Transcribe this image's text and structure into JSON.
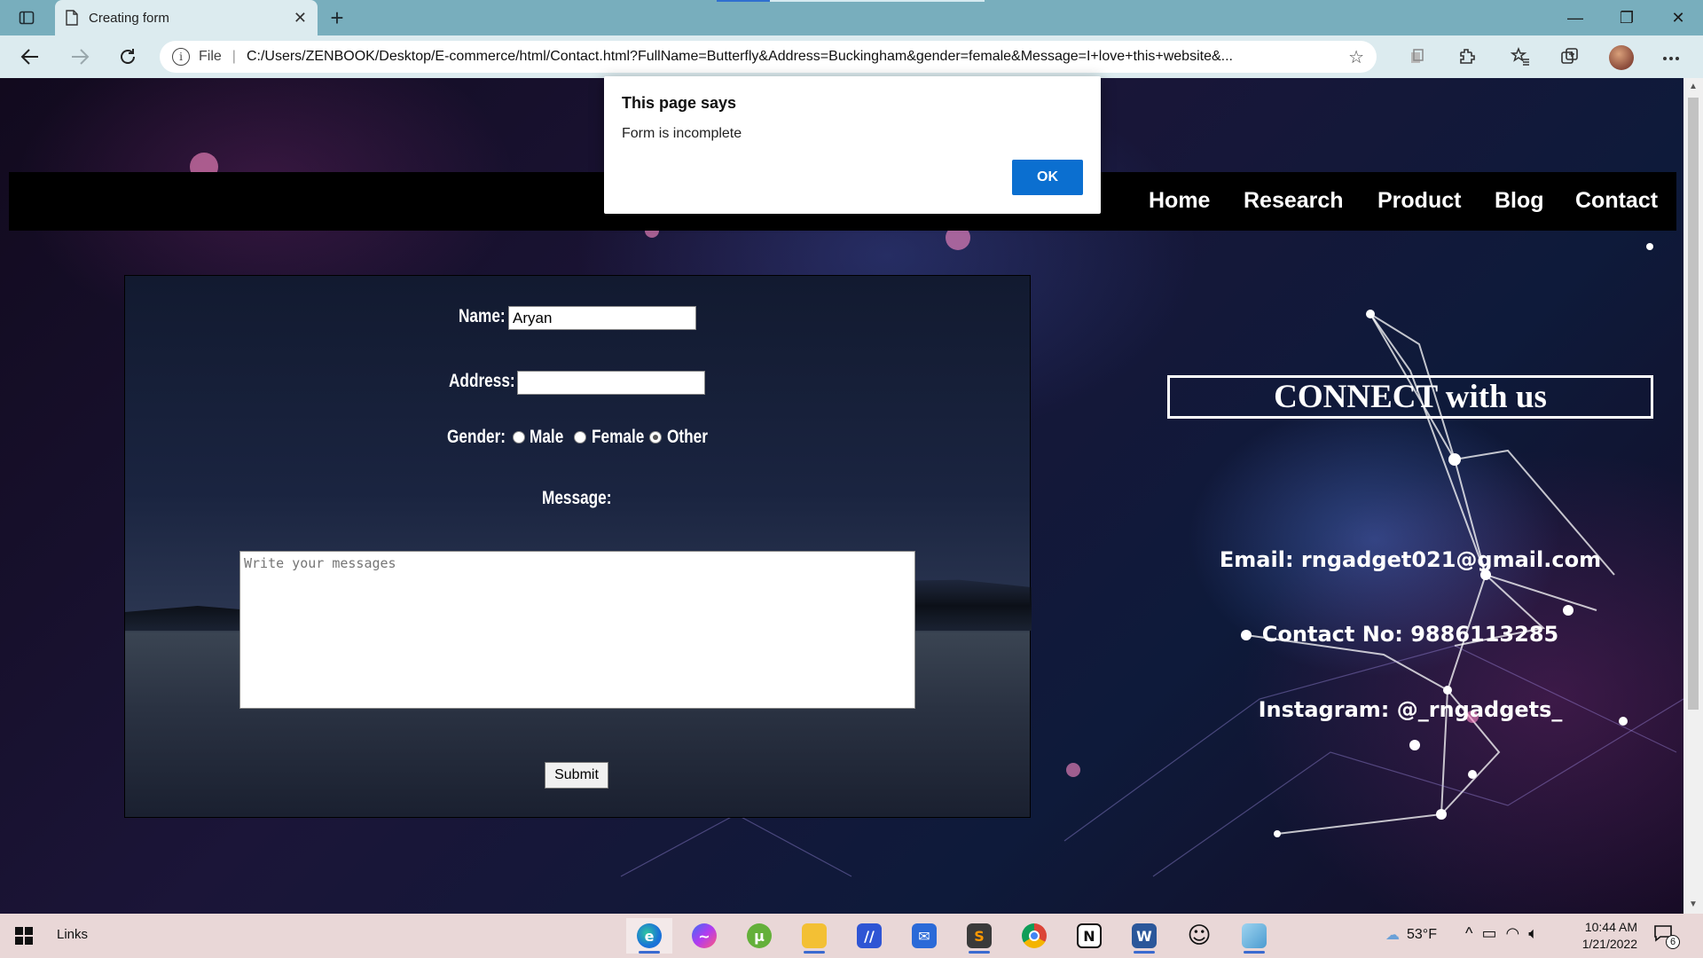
{
  "browser": {
    "tab_title": "Creating form",
    "tab_close": "✕",
    "new_tab": "+",
    "url_prefix": "File",
    "url": "C:/Users/ZENBOOK/Desktop/E-commerce/html/Contact.html?FullName=Butterfly&Address=Buckingham&gender=female&Message=I+love+this+website&...",
    "window_controls": {
      "minimize": "—",
      "maximize": "❐",
      "close": "✕"
    }
  },
  "navbar": {
    "links": [
      "Home",
      "Research",
      "Product",
      "Blog",
      "Contact"
    ]
  },
  "form": {
    "name_label": "Name:",
    "name_value": "Aryan",
    "address_label": "Address:",
    "address_value": "",
    "gender_label": "Gender:",
    "gender_options": [
      "Male",
      "Female",
      "Other"
    ],
    "gender_selected": "Other",
    "message_label": "Message:",
    "message_placeholder": "Write your messages",
    "submit_label": "Submit"
  },
  "contact": {
    "title": "CONNECT with us",
    "email": "Email: rngadget021@gmail.com",
    "phone": "Contact No: 9886113285",
    "instagram": "Instagram: @_rngadgets_"
  },
  "dialog": {
    "title": "This page says",
    "message": "Form is incomplete",
    "ok_label": "OK"
  },
  "taskbar": {
    "links_label": "Links",
    "weather": "53°F",
    "time": "10:44 AM",
    "date": "1/21/2022",
    "notification_count": "6"
  },
  "colors": {
    "browser_tabbar": "#78aebd",
    "browser_toolbar": "#dcebef",
    "dialog_button": "#0b6fd0",
    "taskbar": "#e9d7d7"
  }
}
